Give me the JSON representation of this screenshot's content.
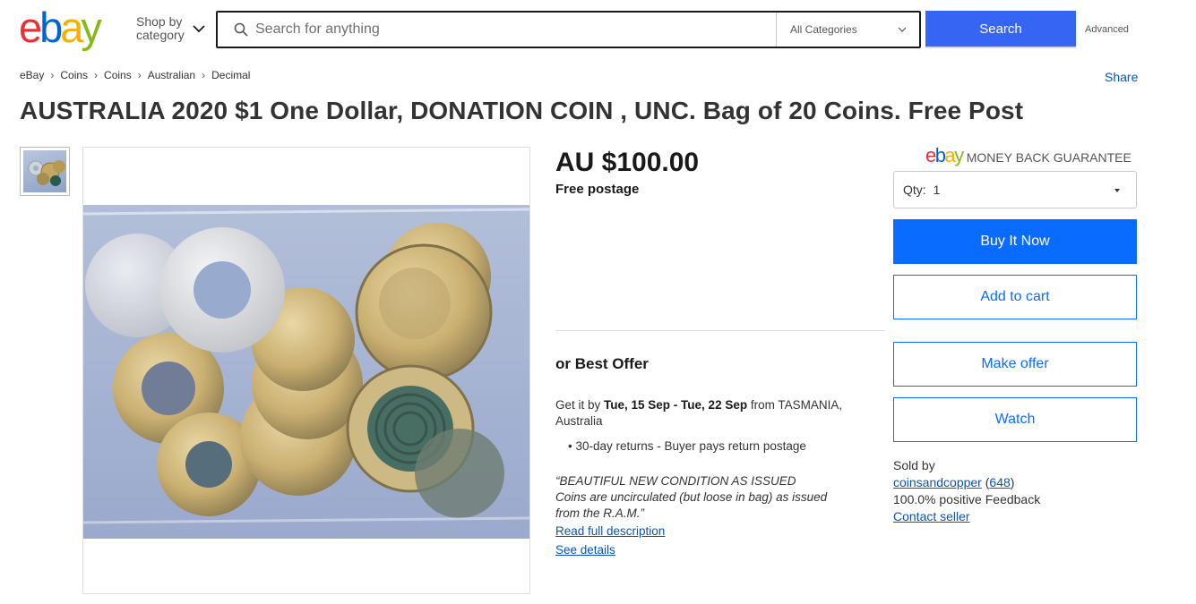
{
  "header": {
    "logo_letters": [
      "e",
      "b",
      "a",
      "y"
    ],
    "shop_by_line1": "Shop by",
    "shop_by_line2": "category",
    "search_placeholder": "Search for anything",
    "category_select": "All Categories",
    "search_button": "Search",
    "advanced_link": "Advanced"
  },
  "breadcrumb": [
    "eBay",
    "Coins",
    "Coins",
    "Australian",
    "Decimal"
  ],
  "share_link": "Share",
  "listing": {
    "title": "AUSTRALIA 2020 $1 One Dollar, DONATION COIN , UNC. Bag of 20 Coins. Free Post",
    "price": "AU $100.00",
    "postage": "Free postage",
    "best_offer": "or Best Offer",
    "delivery_prefix": "Get it by ",
    "delivery_dates": "Tue, 15 Sep - Tue, 22 Sep",
    "delivery_suffix": " from TASMANIA, Australia",
    "returns": "• 30-day returns - Buyer pays return postage",
    "quote_line1": "“BEAUTIFUL NEW CONDITION AS ISSUED",
    "quote_line2": "Coins are uncirculated (but loose in bag) as issued",
    "quote_line3": "from the R.A.M.”",
    "read_more": "Read full description",
    "see_details": "See details"
  },
  "purchase": {
    "guarantee_text": "MONEY BACK GUARANTEE",
    "qty_label": "Qty:",
    "qty_value": "1",
    "buy_now": "Buy It Now",
    "add_to_cart": "Add to cart",
    "make_offer": "Make offer",
    "watch": "Watch"
  },
  "seller": {
    "sold_by_label": "Sold by",
    "name": "coinsandcopper",
    "feedback_count": "648",
    "positive": "100.0% positive Feedback",
    "contact": "Contact seller"
  },
  "colors": {
    "search_blue": "#3665f3",
    "action_blue": "#0a6cff",
    "link_blue": "#0654ba"
  }
}
